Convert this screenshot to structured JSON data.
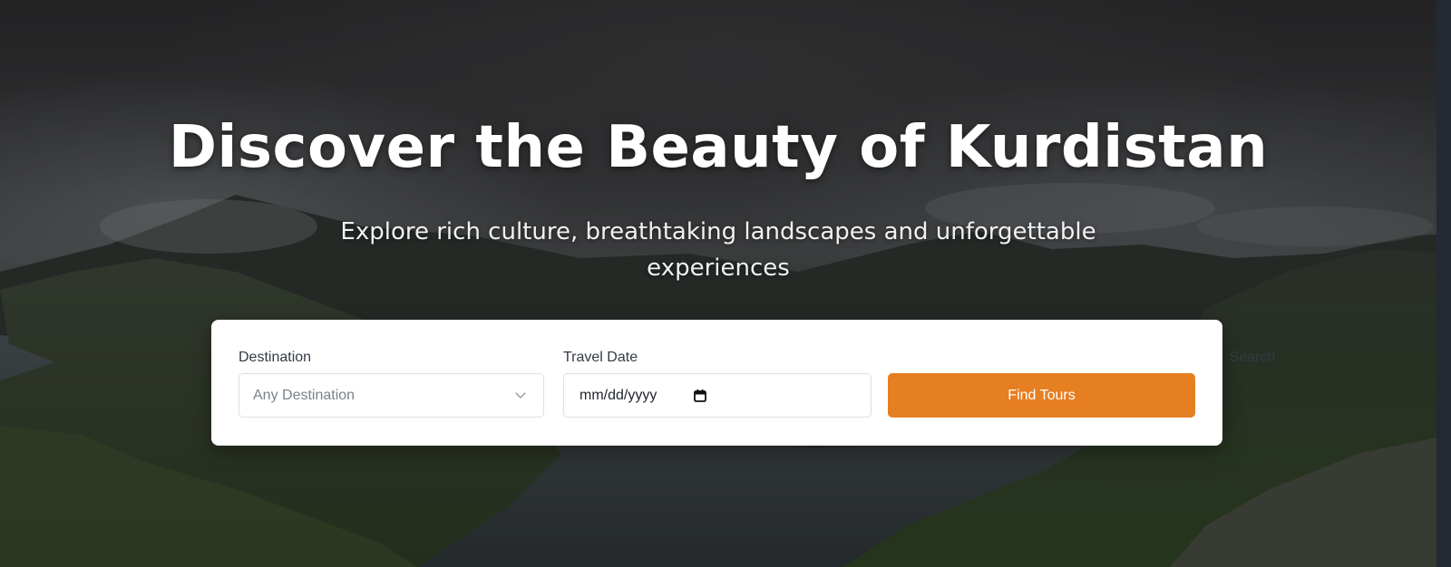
{
  "hero": {
    "title": "Discover the Beauty of Kurdistan",
    "subtitle": "Explore rich culture, breathtaking landscapes and unforgettable experiences"
  },
  "search": {
    "destination_label": "Destination",
    "destination_value": "Any Destination",
    "date_label": "Travel Date",
    "date_placeholder": "mm/dd/yyyy",
    "search_label": "Search",
    "button_label": "Find Tours"
  },
  "icons": {
    "destination_dropdown": "chevron-down-icon",
    "date_picker": "calendar-icon"
  },
  "colors": {
    "accent": "#e67e22",
    "card_background": "#ffffff",
    "title_text": "#ffffff"
  }
}
